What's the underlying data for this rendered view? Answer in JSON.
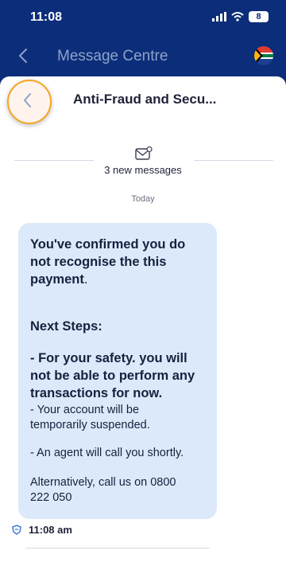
{
  "status_bar": {
    "time": "11:08",
    "battery": "8"
  },
  "nav": {
    "title": "Message Centre"
  },
  "thread": {
    "title": "Anti-Fraud and Secu...",
    "new_messages": "3 new messages",
    "day": "Today"
  },
  "message": {
    "intro_line1": "You've confirmed you do",
    "intro_line2": "not recognise the this",
    "intro_line3": "payment",
    "intro_period": ".",
    "next_steps": "Next Steps:",
    "safety_line1": "- For your safety. you will",
    "safety_line2": "not be able to perform any",
    "safety_line3": "transactions for now.",
    "suspend_line1": "- Your account will be",
    "suspend_line2": "temporarily suspended.",
    "agent": "- An agent will call you shortly.",
    "alt_line1": "Alternatively, call us on 0800",
    "alt_line2": "222 050",
    "time": "11:08 am"
  },
  "colors": {
    "header": "#0b2d7a",
    "bubble": "#dce9fb",
    "highlight": "#f5a623"
  },
  "icons": [
    "signal-icon",
    "wifi-icon",
    "battery-icon",
    "back-chevron-icon",
    "flag-icon",
    "envelope-icon",
    "bank-shield-icon"
  ]
}
